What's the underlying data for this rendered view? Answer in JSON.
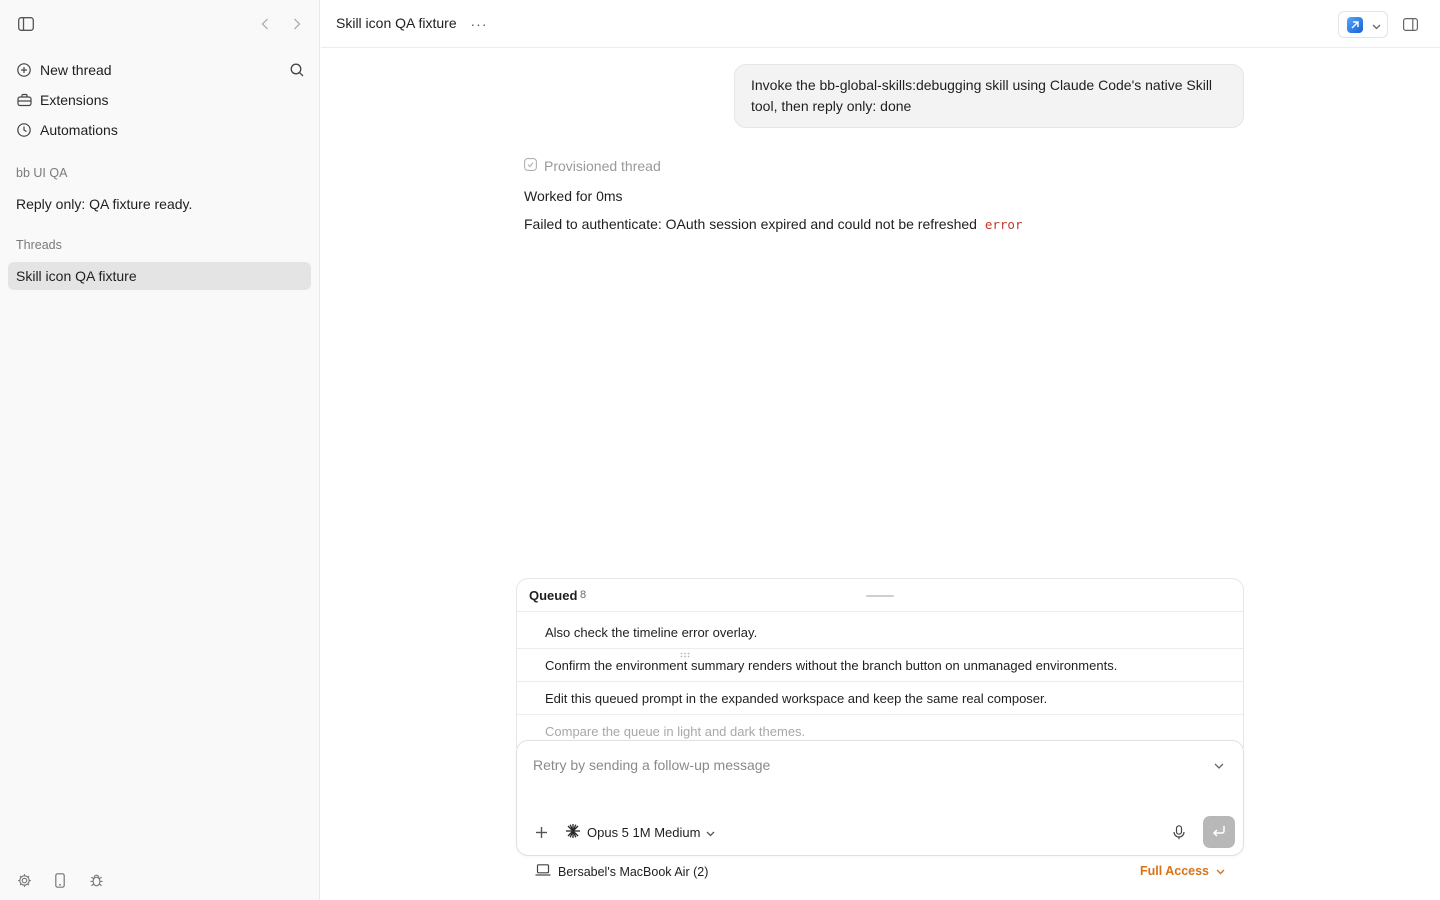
{
  "sidebar": {
    "nav": [
      {
        "label": "New thread",
        "icon": "plus-circle-icon"
      },
      {
        "label": "Extensions",
        "icon": "toolbox-icon"
      },
      {
        "label": "Automations",
        "icon": "clock-icon"
      }
    ],
    "project_label": "bb UI QA",
    "project_item": "Reply only: QA fixture ready.",
    "threads_label": "Threads",
    "threads": [
      {
        "label": "Skill icon QA fixture",
        "active": true
      }
    ]
  },
  "topbar": {
    "title": "Skill icon QA fixture",
    "more": "···"
  },
  "conversation": {
    "user_message": "Invoke the bb-global-skills:debugging skill using Claude Code's native Skill tool, then reply only: done",
    "provisioned": "Provisioned thread",
    "worked": "Worked for 0ms",
    "failed": "Failed to authenticate: OAuth session expired and could not be refreshed",
    "error_code": "error"
  },
  "queue": {
    "title": "Queued",
    "count": "8",
    "items": [
      "Also check the timeline error overlay.",
      "Confirm the environment summary renders without the branch button on unmanaged environments.",
      "Edit this queued prompt in the expanded workspace and keep the same real composer.",
      "Compare the queue in light and dark themes."
    ]
  },
  "composer": {
    "placeholder": "Retry by sending a follow-up message",
    "model": "Opus 5 1M Medium"
  },
  "footer": {
    "device": "Bersabel's MacBook Air (2)",
    "access": "Full Access"
  },
  "colors": {
    "accent_orange": "#d9731a",
    "error_red": "#c0392b",
    "active_item": "#e4e4e4"
  }
}
